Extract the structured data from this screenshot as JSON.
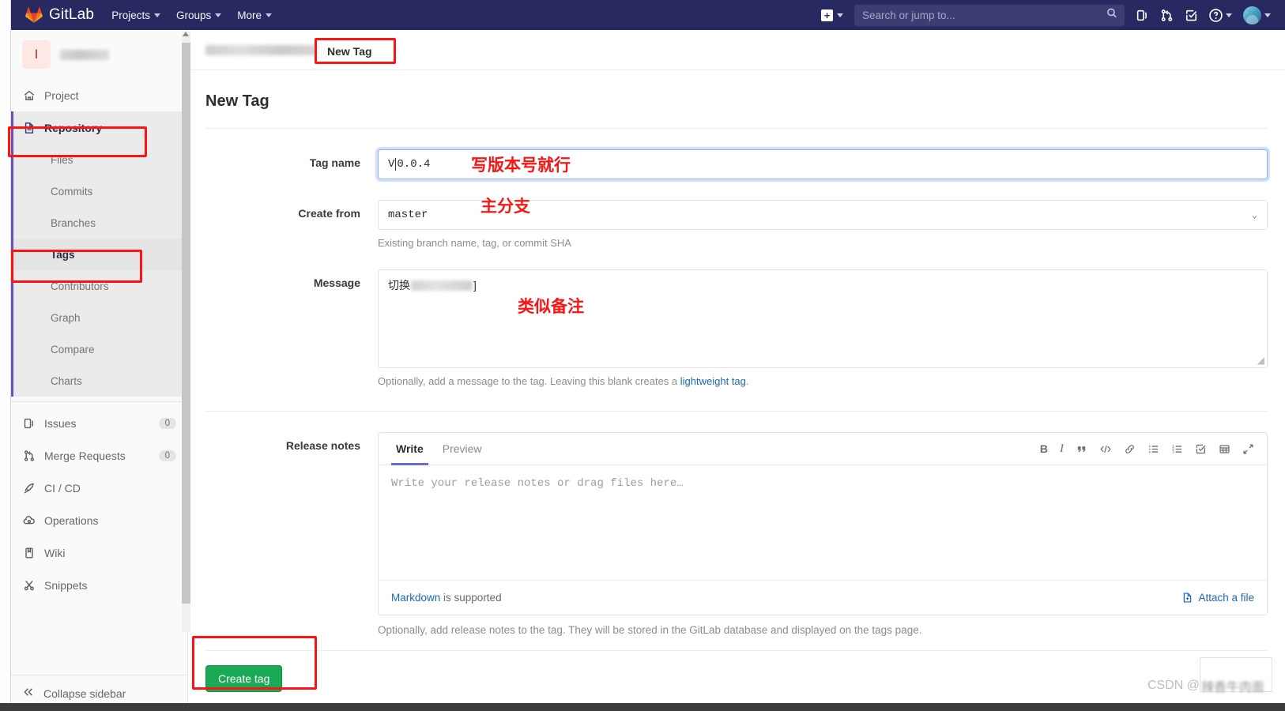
{
  "navbar": {
    "brand": "GitLab",
    "menus": [
      {
        "label": "Projects"
      },
      {
        "label": "Groups"
      },
      {
        "label": "More"
      }
    ],
    "plus_label": "+",
    "search": {
      "placeholder": "Search or jump to..."
    },
    "icons": [
      {
        "name": "issues-icon"
      },
      {
        "name": "merge-requests-icon"
      },
      {
        "name": "todos-icon"
      },
      {
        "name": "help-icon"
      }
    ]
  },
  "sidebar": {
    "project_initial": "I",
    "items": [
      {
        "label": "Project",
        "icon": "home-icon"
      },
      {
        "label": "Repository",
        "icon": "document-icon"
      }
    ],
    "repository_children": [
      {
        "label": "Files"
      },
      {
        "label": "Commits"
      },
      {
        "label": "Branches"
      },
      {
        "label": "Tags"
      },
      {
        "label": "Contributors"
      },
      {
        "label": "Graph"
      },
      {
        "label": "Compare"
      },
      {
        "label": "Charts"
      }
    ],
    "bottom_items": [
      {
        "label": "Issues",
        "icon": "issues-icon",
        "count": "0"
      },
      {
        "label": "Merge Requests",
        "icon": "merge-icon",
        "count": "0"
      },
      {
        "label": "CI / CD",
        "icon": "rocket-icon",
        "count": ""
      },
      {
        "label": "Operations",
        "icon": "cloud-gear-icon",
        "count": ""
      },
      {
        "label": "Wiki",
        "icon": "book-icon",
        "count": ""
      },
      {
        "label": "Snippets",
        "icon": "scissors-icon",
        "count": ""
      }
    ],
    "collapse_label": "Collapse sidebar"
  },
  "breadcrumb": {
    "current": "New Tag"
  },
  "page": {
    "title": "New Tag"
  },
  "form": {
    "tag_name": {
      "label": "Tag name",
      "value_before_caret": "V",
      "value_after_caret": "0.0.4"
    },
    "create_from": {
      "label": "Create from",
      "value": "master",
      "hint": "Existing branch name, tag, or commit SHA"
    },
    "message": {
      "label": "Message",
      "value_prefix": "切换",
      "value_suffix": "]",
      "hint_before": "Optionally, add a message to the tag. Leaving this blank creates a ",
      "hint_link": "lightweight tag",
      "hint_after": "."
    },
    "release_notes": {
      "label": "Release notes",
      "tabs": [
        {
          "label": "Write",
          "active": true
        },
        {
          "label": "Preview",
          "active": false
        }
      ],
      "placeholder": "Write your release notes or drag files here…",
      "toolbar": [
        {
          "name": "bold-icon",
          "glyph": "B"
        },
        {
          "name": "italic-icon",
          "glyph": "I"
        },
        {
          "name": "quote-icon",
          "glyph": "❞"
        },
        {
          "name": "code-icon",
          "glyph": "</>"
        },
        {
          "name": "link-icon",
          "glyph": "🔗"
        },
        {
          "name": "bullet-list-icon",
          "glyph": "≔"
        },
        {
          "name": "numbered-list-icon",
          "glyph": "≕"
        },
        {
          "name": "task-list-icon",
          "glyph": "☑"
        },
        {
          "name": "table-icon",
          "glyph": "▦"
        },
        {
          "name": "fullscreen-icon",
          "glyph": "⤢"
        }
      ],
      "footer_link": "Markdown",
      "footer_text": " is supported",
      "attach_label": "Attach a file",
      "hint": "Optionally, add release notes to the tag. They will be stored in the GitLab database and displayed on the tags page."
    },
    "submit_label": "Create tag"
  },
  "annotations": {
    "tag_name_note": "写版本号就行",
    "create_from_note": "主分支",
    "message_note": "类似备注",
    "highlight_color": "#fb1414"
  },
  "watermark": {
    "prefix": "CSDN @",
    "user": "辣香牛肉面"
  }
}
